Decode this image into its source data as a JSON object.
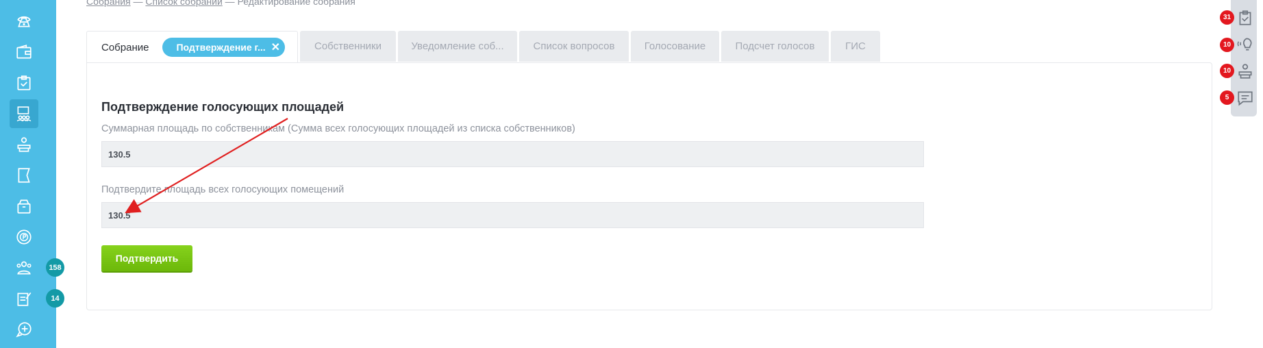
{
  "breadcrumb": {
    "item1": "Собрания",
    "sep1": " — ",
    "item2": "Список собраний",
    "sep2": " — ",
    "current": "Редактирование собрания"
  },
  "tabs": [
    {
      "label": "Собрание"
    },
    {
      "label": "Собственники"
    },
    {
      "label": "Уведомление соб..."
    },
    {
      "label": "Список вопросов"
    },
    {
      "label": "Голосование"
    },
    {
      "label": "Подсчет голосов"
    },
    {
      "label": "ГИС"
    }
  ],
  "chip": {
    "label": "Подтверждение г...",
    "close": "✕"
  },
  "form": {
    "heading": "Подтверждение голосующих площадей",
    "total_label": "Суммарная площадь по собственникам (Сумма всех голосующих площадей из списка собственников)",
    "total_value": "130.5",
    "confirm_label": "Подтвердите площадь всех голосующих помещений",
    "confirm_value": "130.5",
    "submit": "Подтвердить"
  },
  "sidebar": {
    "items": [
      "phone-icon",
      "wallet-icon",
      "clipboard-check-icon",
      "meeting-icon",
      "reception-icon",
      "flag-icon",
      "archive-icon",
      "coin-icon",
      "people-icon",
      "edit-document-icon",
      "chat-plus-icon"
    ],
    "badges": {
      "people": "158",
      "documents": "14"
    }
  },
  "right_panel": {
    "badges": {
      "tasks": "31",
      "requests": "10",
      "reception": "10",
      "messages": "5"
    }
  },
  "colors": {
    "sidebar": "#4dbde6",
    "accent_green": "#78c414",
    "badge_teal": "#139aa6",
    "badge_red": "#e3181f",
    "arrow": "#e02020"
  }
}
